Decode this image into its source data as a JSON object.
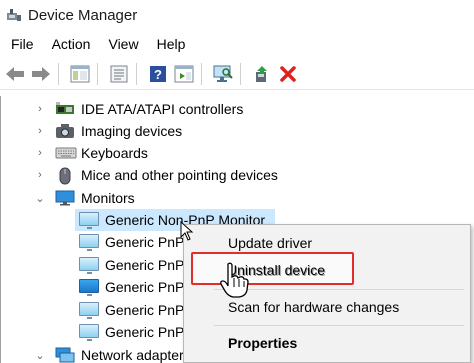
{
  "window": {
    "title": "Device Manager"
  },
  "menu": {
    "file": "File",
    "action": "Action",
    "view": "View",
    "help": "Help"
  },
  "toolbar": {
    "icons": [
      "back-arrow-icon",
      "forward-arrow-icon",
      "properties-icon",
      "update-driver-icon",
      "help-icon",
      "show-hidden-icon",
      "scan-hardware-icon",
      "enable-device-icon",
      "uninstall-x-icon"
    ],
    "colors": {
      "uninstall_x": "#e0201f",
      "arrows": "#7a7a7a"
    }
  },
  "tree": {
    "categories": [
      {
        "label": "IDE ATA/ATAPI controllers",
        "icon": "ide-controller-icon",
        "expanded": false
      },
      {
        "label": "Imaging devices",
        "icon": "camera-icon",
        "expanded": false
      },
      {
        "label": "Keyboards",
        "icon": "keyboard-icon",
        "expanded": false
      },
      {
        "label": "Mice and other pointing devices",
        "icon": "mouse-icon",
        "expanded": false
      },
      {
        "label": "Monitors",
        "icon": "monitor-icon",
        "expanded": true
      },
      {
        "label": "Network adapters",
        "icon": "network-adapter-icon",
        "expanded": false
      }
    ],
    "monitors": [
      {
        "label": "Generic Non-PnP Monitor",
        "selected": true
      },
      {
        "label": "Generic PnP"
      },
      {
        "label": "Generic PnP"
      },
      {
        "label": "Generic PnP"
      },
      {
        "label": "Generic PnP"
      },
      {
        "label": "Generic PnP"
      }
    ]
  },
  "context_menu": {
    "update_driver": "Update driver",
    "uninstall_device": "Uninstall device",
    "scan": "Scan for hardware changes",
    "properties": "Properties",
    "highlight_color": "#e22d2d"
  },
  "colors": {
    "selection": "#cce8ff"
  }
}
